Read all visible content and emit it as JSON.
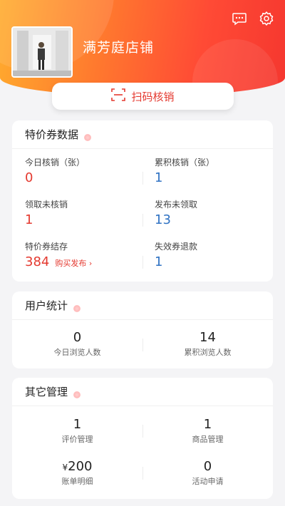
{
  "store": {
    "name": "满芳庭店铺"
  },
  "header": {
    "message_icon": "chat-bubble-icon",
    "settings_icon": "gear-icon"
  },
  "scan_button": {
    "label": "扫码核销",
    "icon": "scan-icon"
  },
  "coupon_section": {
    "title": "特价券数据",
    "items": [
      {
        "label": "今日核销（张）",
        "value": "0"
      },
      {
        "label": "累积核销（张）",
        "value": "1"
      },
      {
        "label": "领取未核销",
        "value": "1"
      },
      {
        "label": "发布未领取",
        "value": "13"
      },
      {
        "label": "特价券结存",
        "value": "384"
      },
      {
        "label": "失效券退款",
        "value": "1"
      }
    ],
    "buy_link": "购买发布"
  },
  "user_section": {
    "title": "用户统计",
    "items": [
      {
        "value": "0",
        "label": "今日浏览人数"
      },
      {
        "value": "14",
        "label": "累积浏览人数"
      }
    ]
  },
  "other_section": {
    "title": "其它管理",
    "items": [
      {
        "value": "1",
        "label": "评价管理"
      },
      {
        "value": "1",
        "label": "商品管理"
      },
      {
        "prefix": "¥",
        "value": "200",
        "label": "账单明细"
      },
      {
        "value": "0",
        "label": "活动申请"
      }
    ]
  },
  "colors": {
    "accent_red": "#e4392f",
    "accent_blue": "#2f72c3",
    "header_orange": "#ff7a2e"
  }
}
